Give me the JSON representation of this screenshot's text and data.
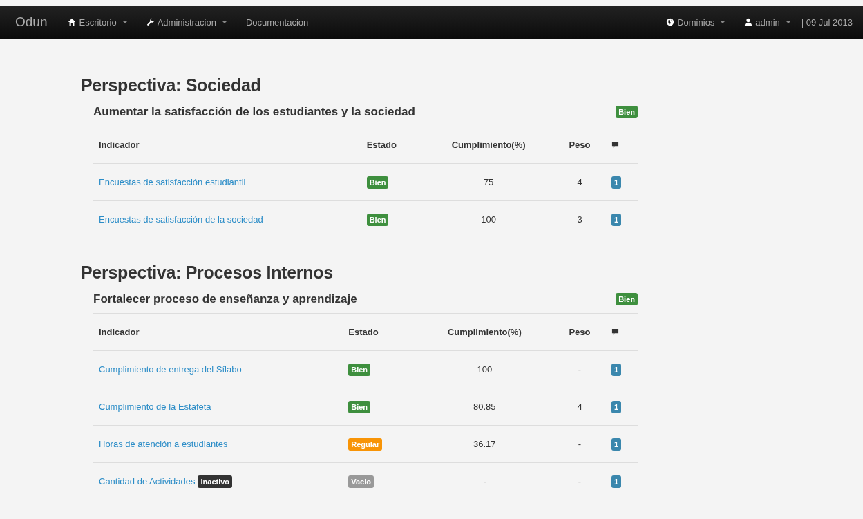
{
  "navbar": {
    "brand": "Odun",
    "menus": [
      {
        "label": "Escritorio",
        "dropdown": true
      },
      {
        "label": "Administracion",
        "dropdown": true
      },
      {
        "label": "Documentacion",
        "dropdown": false
      }
    ],
    "right_menus": [
      {
        "label": "Dominios",
        "dropdown": true
      },
      {
        "label": "admin",
        "dropdown": true
      }
    ],
    "date": "| 09 Jul 2013"
  },
  "perspectives": [
    {
      "title": "Perspectiva: Sociedad",
      "objectives": [
        {
          "title": "Aumentar la satisfacción de los estudiantes y la sociedad",
          "status": "Bien",
          "color": "#3e8f3e",
          "columns": [
            "Indicador",
            "Estado",
            "Cumplimiento(%)",
            "Peso"
          ],
          "rows": [
            {
              "indicator": "Encuestas de satisfacción estudiantil",
              "tag": null,
              "status": "Bien",
              "color": "#3e8f3e",
              "cumplimiento": "75",
              "peso": "4",
              "comments": "1"
            },
            {
              "indicator": "Encuestas de satisfacción de la sociedad",
              "tag": null,
              "status": "Bien",
              "color": "#3e8f3e",
              "cumplimiento": "100",
              "peso": "3",
              "comments": "1"
            }
          ]
        }
      ]
    },
    {
      "title": "Perspectiva: Procesos Internos",
      "objectives": [
        {
          "title": "Fortalecer proceso de enseñanza y aprendizaje",
          "status": "Bien",
          "color": "#3e8f3e",
          "columns": [
            "Indicador",
            "Estado",
            "Cumplimiento(%)",
            "Peso"
          ],
          "rows": [
            {
              "indicator": "Cumplimiento de entrega del Sílabo",
              "tag": null,
              "status": "Bien",
              "color": "#3e8f3e",
              "cumplimiento": "100",
              "peso": "-",
              "comments": "1"
            },
            {
              "indicator": "Cumplimiento de la Estafeta",
              "tag": null,
              "status": "Bien",
              "color": "#3e8f3e",
              "cumplimiento": "80.85",
              "peso": "4",
              "comments": "1"
            },
            {
              "indicator": "Horas de atención a estudiantes",
              "tag": null,
              "status": "Regular",
              "color": "#f89406",
              "cumplimiento": "36.17",
              "peso": "-",
              "comments": "1"
            },
            {
              "indicator": "Cantidad de Actividades",
              "tag": "inactivo",
              "status": "Vacio",
              "color": "#999999",
              "cumplimiento": "-",
              "peso": "-",
              "comments": "1"
            }
          ]
        }
      ]
    }
  ]
}
